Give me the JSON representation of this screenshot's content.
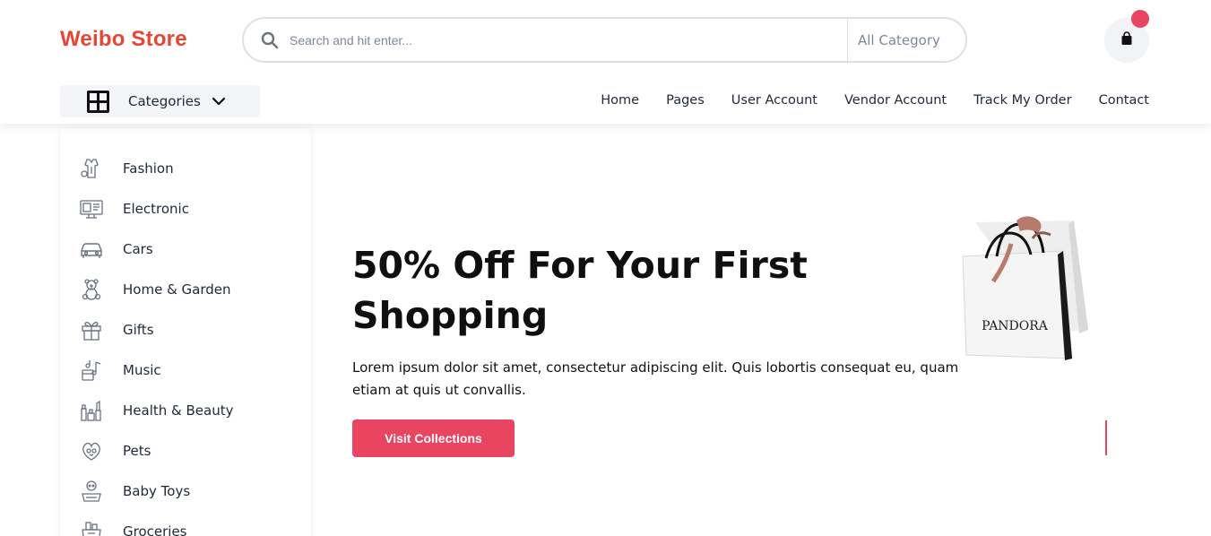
{
  "header": {
    "logo": "Weibo Store",
    "search": {
      "placeholder": "Search and hit enter...",
      "category": "All Category"
    },
    "cart": {
      "icon": "shopping-bag-icon"
    }
  },
  "categories_button": {
    "label": "Categories"
  },
  "nav": [
    "Home",
    "Pages",
    "User Account",
    "Vendor Account",
    "Track My Order",
    "Contact"
  ],
  "sidebar": [
    {
      "label": "Fashion",
      "icon": "dress-icon"
    },
    {
      "label": "Electronic",
      "icon": "monitor-icon"
    },
    {
      "label": "Cars",
      "icon": "car-icon"
    },
    {
      "label": "Home & Garden",
      "icon": "teddy-bear-icon"
    },
    {
      "label": "Gifts",
      "icon": "gift-icon"
    },
    {
      "label": "Music",
      "icon": "music-icon"
    },
    {
      "label": "Health & Beauty",
      "icon": "cosmetics-icon"
    },
    {
      "label": "Pets",
      "icon": "pets-icon"
    },
    {
      "label": "Baby Toys",
      "icon": "baby-toys-icon"
    },
    {
      "label": "Groceries",
      "icon": "groceries-icon"
    }
  ],
  "hero": {
    "title": "50% Off For Your First Shopping",
    "description": "Lorem ipsum dolor sit amet, consectetur adipiscing elit. Quis lobortis consequat eu, quam etiam at quis ut convallis.",
    "button": "Visit Collections",
    "image_brand": "PANDORA"
  },
  "colors": {
    "brand": "#e94535",
    "accent": "#e94560"
  }
}
